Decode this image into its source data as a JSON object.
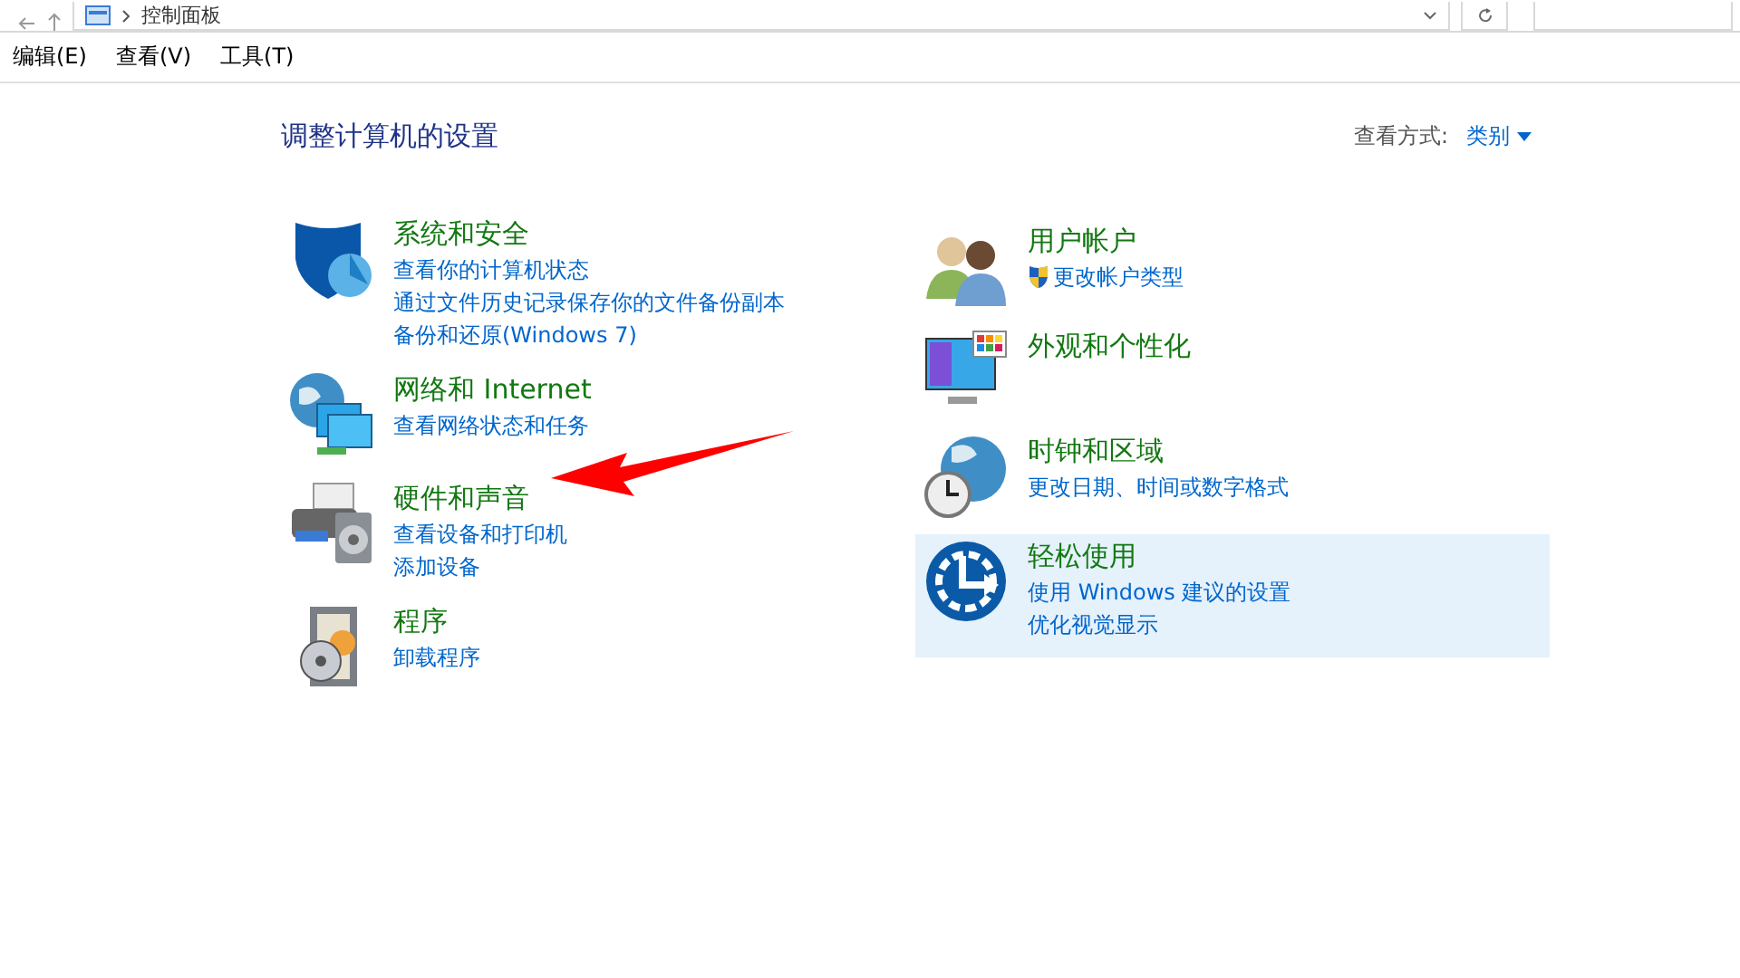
{
  "address_bar": {
    "path": "控制面板"
  },
  "menu": [
    "编辑(E)",
    "查看(V)",
    "工具(T)"
  ],
  "heading": "调整计算机的设置",
  "view_by": {
    "label": "查看方式:",
    "value": "类别"
  },
  "columns": [
    [
      {
        "kind": "shield",
        "title": "系统和安全",
        "selected": false,
        "links": [
          {
            "text": "查看你的计算机状态",
            "shield": false
          },
          {
            "text": "通过文件历史记录保存你的文件备份副本",
            "shield": false
          },
          {
            "text": "备份和还原(Windows 7)",
            "shield": false
          }
        ]
      },
      {
        "kind": "network",
        "title": "网络和 Internet",
        "selected": false,
        "links": [
          {
            "text": "查看网络状态和任务",
            "shield": false
          }
        ]
      },
      {
        "kind": "hardware",
        "title": "硬件和声音",
        "selected": false,
        "links": [
          {
            "text": "查看设备和打印机",
            "shield": false
          },
          {
            "text": "添加设备",
            "shield": false
          }
        ]
      },
      {
        "kind": "programs",
        "title": "程序",
        "selected": false,
        "links": [
          {
            "text": "卸载程序",
            "shield": false
          }
        ]
      }
    ],
    [
      {
        "kind": "users",
        "title": "用户帐户",
        "selected": false,
        "links": [
          {
            "text": "更改帐户类型",
            "shield": true
          }
        ]
      },
      {
        "kind": "display",
        "title": "外观和个性化",
        "selected": false
      },
      {
        "kind": "clock",
        "title": "时钟和区域",
        "selected": false,
        "links": [
          {
            "text": "更改日期、时间或数字格式",
            "shield": false
          }
        ]
      },
      {
        "kind": "access",
        "title": "轻松使用",
        "selected": true,
        "links": [
          {
            "text": "使用 Windows 建议的设置",
            "shield": false
          },
          {
            "text": "优化视觉显示",
            "shield": false
          }
        ]
      }
    ]
  ]
}
